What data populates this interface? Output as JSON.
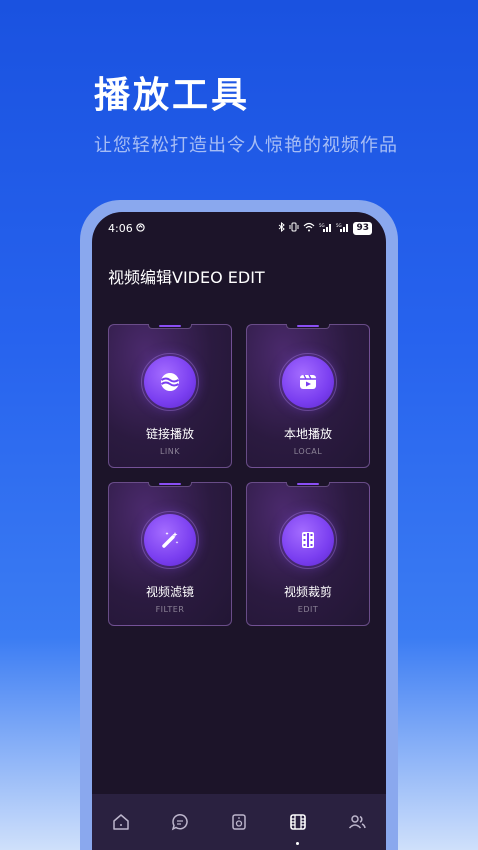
{
  "hero": {
    "title": "播放工具",
    "subtitle": "让您轻松打造出令人惊艳的视频作品"
  },
  "status_bar": {
    "time": "4:06",
    "battery": "93"
  },
  "page": {
    "title": "视频编辑VIDEO EDIT"
  },
  "cards": [
    {
      "label": "链接播放",
      "sub": "LINK",
      "icon": "planet-icon"
    },
    {
      "label": "本地播放",
      "sub": "LOCAL",
      "icon": "video-folder-icon"
    },
    {
      "label": "视频滤镜",
      "sub": "FILTER",
      "icon": "magic-wand-icon"
    },
    {
      "label": "视频裁剪",
      "sub": "EDIT",
      "icon": "film-strip-icon"
    }
  ],
  "tabs": [
    {
      "icon": "home-icon",
      "active": false
    },
    {
      "icon": "chat-icon",
      "active": false
    },
    {
      "icon": "speaker-icon",
      "active": false
    },
    {
      "icon": "film-icon",
      "active": true
    },
    {
      "icon": "users-icon",
      "active": false
    }
  ],
  "colors": {
    "background": "#2763ee",
    "screen": "#1c1429",
    "accent": "#7a3ef0"
  }
}
